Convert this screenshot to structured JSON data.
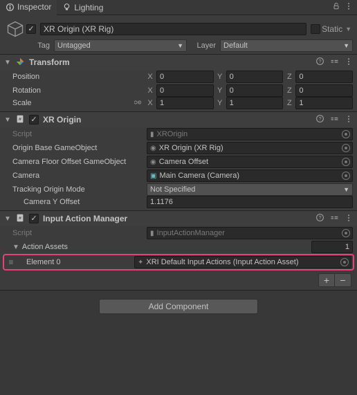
{
  "tabs": {
    "inspector": "Inspector",
    "lighting": "Lighting"
  },
  "gameobject": {
    "name": "XR Origin (XR Rig)",
    "static_label": "Static",
    "tag_label": "Tag",
    "tag_value": "Untagged",
    "layer_label": "Layer",
    "layer_value": "Default"
  },
  "transform": {
    "title": "Transform",
    "position_label": "Position",
    "rotation_label": "Rotation",
    "scale_label": "Scale",
    "x": "X",
    "y": "Y",
    "z": "Z",
    "pos": {
      "x": "0",
      "y": "0",
      "z": "0"
    },
    "rot": {
      "x": "0",
      "y": "0",
      "z": "0"
    },
    "scl": {
      "x": "1",
      "y": "1",
      "z": "1"
    }
  },
  "xrorigin": {
    "title": "XR Origin",
    "script_label": "Script",
    "script_value": "XROrigin",
    "origin_base_label": "Origin Base GameObject",
    "origin_base_value": "XR Origin (XR Rig)",
    "camera_floor_label": "Camera Floor Offset GameObject",
    "camera_floor_value": "Camera Offset",
    "camera_label": "Camera",
    "camera_value": "Main Camera (Camera)",
    "tracking_label": "Tracking Origin Mode",
    "tracking_value": "Not Specified",
    "camera_y_label": "Camera Y Offset",
    "camera_y_value": "1.1176"
  },
  "iam": {
    "title": "Input Action Manager",
    "script_label": "Script",
    "script_value": "InputActionManager",
    "assets_label": "Action Assets",
    "size": "1",
    "element0_label": "Element 0",
    "element0_value": "XRI Default Input Actions (Input Action Asset)"
  },
  "add_component": "Add Component"
}
